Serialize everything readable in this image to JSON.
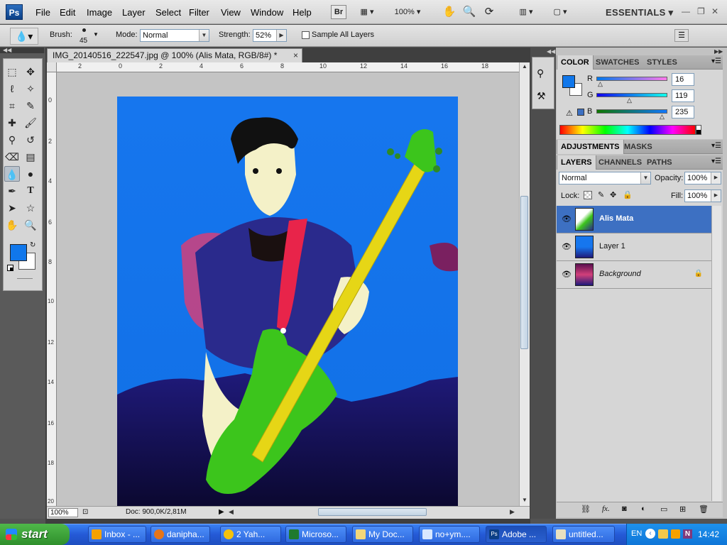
{
  "app": {
    "logo": "Ps",
    "workspace": "ESSENTIALS"
  },
  "menus": [
    "File",
    "Edit",
    "Image",
    "Layer",
    "Select",
    "Filter",
    "View",
    "Window",
    "Help"
  ],
  "appbar": {
    "bridge": "Br",
    "zoom": "100%"
  },
  "options": {
    "brush_label": "Brush:",
    "brush_size": "45",
    "mode_label": "Mode:",
    "mode_value": "Normal",
    "strength_label": "Strength:",
    "strength_value": "52%",
    "sample_label": "Sample All Layers"
  },
  "document": {
    "tab_title": "IMG_20140516_222547.jpg @ 100% (Alis Mata, RGB/8#) *",
    "close": "×",
    "zoom": "100%",
    "doc_size": "Doc: 900,0K/2,81M"
  },
  "ruler": {
    "h": [
      "2",
      "0",
      "2",
      "4",
      "6",
      "8",
      "10",
      "12",
      "14",
      "16",
      "18"
    ],
    "v": [
      "0",
      "2",
      "4",
      "6",
      "8",
      "10",
      "12",
      "14",
      "16",
      "18",
      "20"
    ]
  },
  "color_panel": {
    "tabs": [
      "COLOR",
      "SWATCHES",
      "STYLES"
    ],
    "r_label": "R",
    "g_label": "G",
    "b_label": "B",
    "r": "16",
    "g": "119",
    "b": "235",
    "fg_hex": "#1077eb"
  },
  "adjust_panel": {
    "tabs": [
      "ADJUSTMENTS",
      "MASKS"
    ]
  },
  "layers_panel": {
    "tabs": [
      "LAYERS",
      "CHANNELS",
      "PATHS"
    ],
    "blend": "Normal",
    "opacity_label": "Opacity:",
    "opacity": "100%",
    "lock_label": "Lock:",
    "fill_label": "Fill:",
    "fill": "100%",
    "layers": [
      {
        "name": "Alis Mata",
        "selected": true
      },
      {
        "name": "Layer 1",
        "selected": false
      },
      {
        "name": "Background",
        "selected": false
      }
    ]
  },
  "taskbar": {
    "start": "start",
    "tasks": [
      "Inbox - ...",
      "danipha...",
      "2 Yah...",
      "Microso...",
      "My Doc...",
      "no+ym....",
      "Adobe ...",
      "untitled..."
    ],
    "lang": "EN",
    "clock": "14:42"
  }
}
